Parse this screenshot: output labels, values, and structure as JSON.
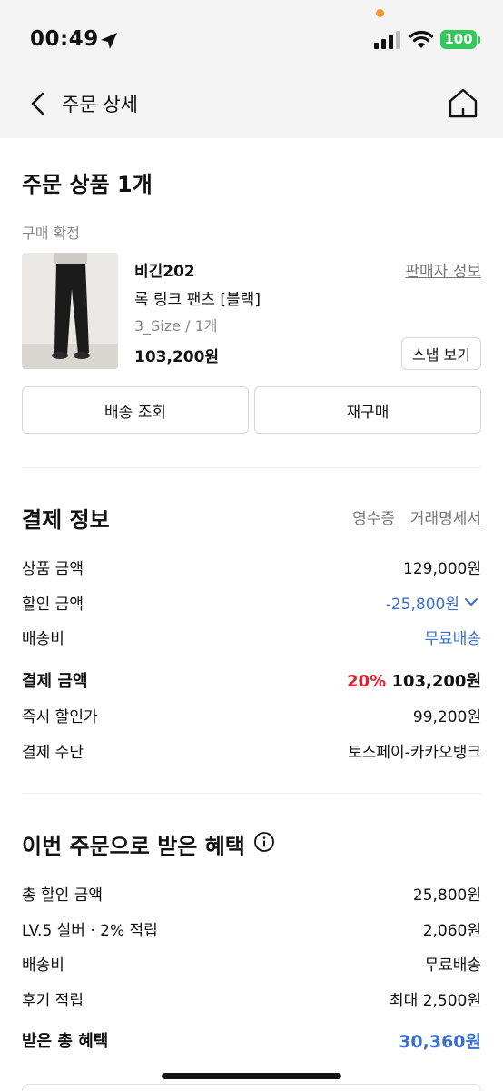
{
  "status_bar": {
    "time": "00:49",
    "battery": "100"
  },
  "nav": {
    "title": "주문 상세"
  },
  "order_products": {
    "heading": "주문 상품 1개",
    "status": "구매 확정",
    "item": {
      "brand": "비긴202",
      "name": "록 링크 팬츠 [블랙]",
      "option": "3_Size / 1개",
      "price": "103,200원",
      "seller_info_link": "판매자 정보",
      "snap_button": "스냅 보기"
    },
    "buttons": {
      "delivery": "배송 조회",
      "reorder": "재구매"
    }
  },
  "payment": {
    "heading": "결제 정보",
    "receipt_link": "영수증",
    "statement_link": "거래명세서",
    "rows": [
      {
        "label": "상품 금액",
        "value": "129,000원"
      },
      {
        "label": "할인 금액",
        "value": "-25,800원"
      },
      {
        "label": "배송비",
        "value": "무료배송"
      }
    ],
    "total": {
      "label": "결제 금액",
      "discount_rate": "20%",
      "value": "103,200원"
    },
    "rows2": [
      {
        "label": "즉시 할인가",
        "value": "99,200원"
      },
      {
        "label": "결제 수단",
        "value": "토스페이-카카오뱅크"
      }
    ]
  },
  "benefits": {
    "heading": "이번 주문으로 받은 혜택",
    "rows": [
      {
        "label": "총 할인 금액",
        "value": "25,800원"
      },
      {
        "label": "LV.5 실버 · 2% 적립",
        "value": "2,060원"
      },
      {
        "label": "배송비",
        "value": "무료배송"
      },
      {
        "label": "후기 적립",
        "value": "최대 2,500원"
      }
    ],
    "total": {
      "label": "받은 총 혜택",
      "value": "30,360원"
    }
  },
  "colors": {
    "accent_blue": "#3a6fcf",
    "discount_red": "#e0202f",
    "battery_green": "#34c759"
  }
}
